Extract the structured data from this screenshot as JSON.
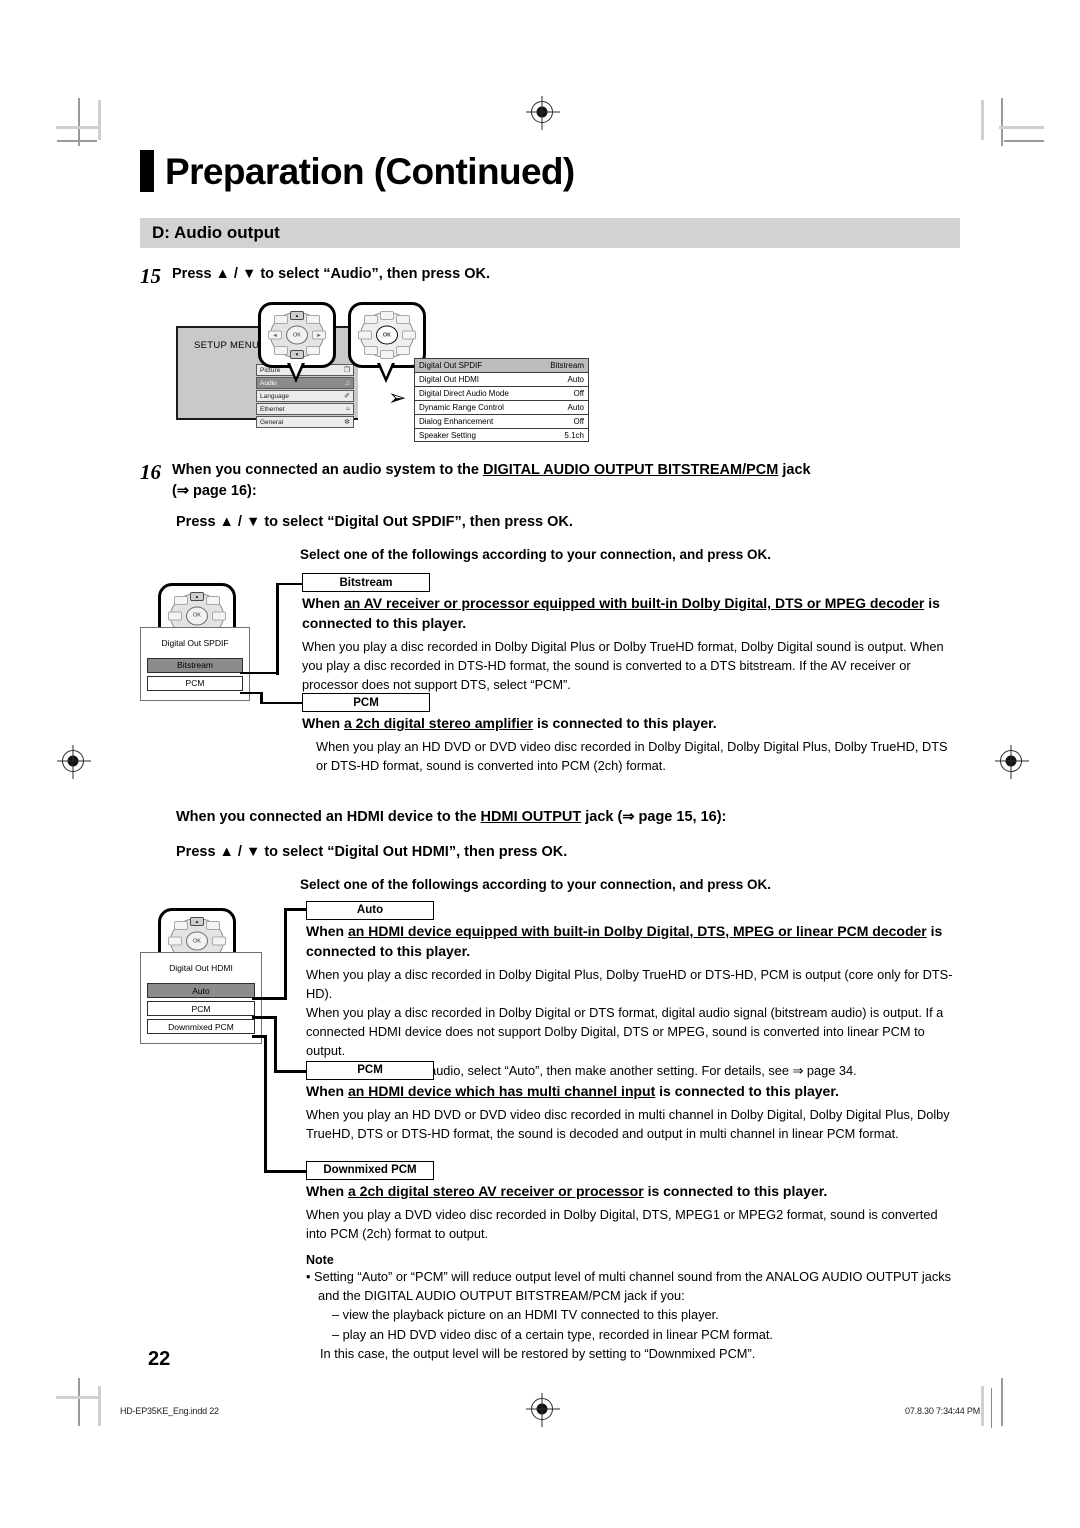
{
  "header": {
    "chapter_title": "Preparation (Continued)",
    "section_band": "D: Audio output"
  },
  "step15": {
    "number": "15",
    "text": "Press ▲ / ▼ to select “Audio”, then press OK."
  },
  "setup_figure": {
    "screen_label": "SETUP MENU",
    "menu_items": [
      {
        "label": "Picture",
        "icon": "❐"
      },
      {
        "label": "Audio",
        "icon": "♫",
        "selected": true
      },
      {
        "label": "Language",
        "icon": "✐"
      },
      {
        "label": "Ethernet",
        "icon": "≈"
      },
      {
        "label": "General",
        "icon": "✼"
      }
    ],
    "ok_label": "OK",
    "settings_table": [
      {
        "name": "Digital Out SPDIF",
        "value": "Bitstream",
        "selected": true
      },
      {
        "name": "Digital Out HDMI",
        "value": "Auto"
      },
      {
        "name": "Digital Direct Audio Mode",
        "value": "Off"
      },
      {
        "name": "Dynamic Range Control",
        "value": "Auto"
      },
      {
        "name": "Dialog Enhancement",
        "value": "Off"
      },
      {
        "name": "Speaker Setting",
        "value": "5.1ch"
      }
    ]
  },
  "step16": {
    "number": "16",
    "line1_a": "When you connected an audio system to the ",
    "line1_u": "DIGITAL AUDIO OUTPUT BITSTREAM/PCM",
    "line1_b": " jack",
    "line2": "(⇒ page 16):",
    "press_line": "Press ▲ / ▼ to select “Digital Out SPDIF”, then press OK.",
    "select_line": "Select one of the followings according to your connection, and press OK."
  },
  "spdif_figure": {
    "box_title": "Digital Out SPDIF",
    "options": [
      {
        "label": "Bitstream",
        "selected": true
      },
      {
        "label": "PCM",
        "selected": false
      }
    ]
  },
  "spdif_bitstream": {
    "tag": "Bitstream",
    "head_a": "When ",
    "head_u": "an AV receiver or processor equipped with built-in Dolby Digital, DTS or MPEG decoder",
    "head_b": " is connected to this player.",
    "body": "When you play a disc recorded in Dolby Digital Plus or Dolby TrueHD format, Dolby Digital sound is output. When you play a disc recorded in DTS-HD format, the sound is converted to a DTS bitstream. If the AV receiver or processor does not support DTS, select “PCM”."
  },
  "spdif_pcm": {
    "tag": "PCM",
    "head_a": "When ",
    "head_u": "a 2ch digital stereo amplifier",
    "head_b": " is connected to this player.",
    "body": "When you play an HD DVD or DVD video disc recorded in Dolby Digital, Dolby Digital Plus, Dolby TrueHD, DTS or DTS-HD format, sound is converted into PCM (2ch) format."
  },
  "hdmi_intro": {
    "line_a": "When you connected an HDMI device to the ",
    "line_u": "HDMI OUTPUT",
    "line_b": " jack (⇒ page 15, 16):",
    "press_line": "Press ▲ / ▼ to select “Digital Out HDMI”, then press OK.",
    "select_line": "Select one of the followings according to your connection, and press OK."
  },
  "hdmi_figure": {
    "box_title": "Digital Out HDMI",
    "options": [
      {
        "label": "Auto",
        "selected": true
      },
      {
        "label": "PCM",
        "selected": false
      },
      {
        "label": "Downmixed PCM",
        "selected": false
      }
    ]
  },
  "hdmi_auto": {
    "tag": "Auto",
    "head_a": "When ",
    "head_u": "an HDMI device equipped with built-in Dolby Digital, DTS, MPEG or linear PCM decoder",
    "head_b": " is connected to this player.",
    "body1": "When you play a disc recorded in Dolby Digital Plus, Dolby TrueHD or DTS-HD, PCM is output (core only for DTS-HD).",
    "body2": "When you play a disc recorded in Dolby Digital or DTS format, digital audio signal (bitstream audio) is output. If a connected HDMI device does not support Dolby Digital, DTS or MPEG, sound is converted into linear PCM to output.",
    "body3": "To output high bitrate audio, select “Auto”, then make another setting. For details, see ⇒ page 34."
  },
  "hdmi_pcm": {
    "tag": "PCM",
    "head_a": "When ",
    "head_u": "an HDMI device which has multi channel input",
    "head_b": " is connected to this player.",
    "body": "When you play an HD DVD or DVD video disc recorded in multi channel in Dolby Digital, Dolby Digital Plus, Dolby TrueHD, DTS or DTS-HD format, the sound is decoded and output in multi channel in linear PCM format."
  },
  "hdmi_downmixed": {
    "tag": "Downmixed PCM",
    "head_a": "When ",
    "head_u": "a 2ch digital stereo AV receiver or processor",
    "head_b": " is connected to this player.",
    "body": "When you play a DVD video disc recorded in Dolby Digital, DTS, MPEG1 or MPEG2 format, sound is converted into PCM (2ch) format to output."
  },
  "note": {
    "title": "Note",
    "bullet": "•  Setting “Auto” or “PCM” will reduce output level of multi channel sound from the ANALOG AUDIO OUTPUT jacks and the DIGITAL AUDIO OUTPUT BITSTREAM/PCM jack if you:",
    "dash1": "– view the playback picture on an HDMI TV connected to this player.",
    "dash2": "– play an HD DVD video disc of a certain type, recorded in linear PCM format.",
    "closing": "In this case, the output level will be restored by setting to “Downmixed PCM”."
  },
  "footer": {
    "page_number": "22",
    "file_name": "HD-EP35KE_Eng.indd   22",
    "timestamp": "07.8.30   7:34:44 PM"
  }
}
